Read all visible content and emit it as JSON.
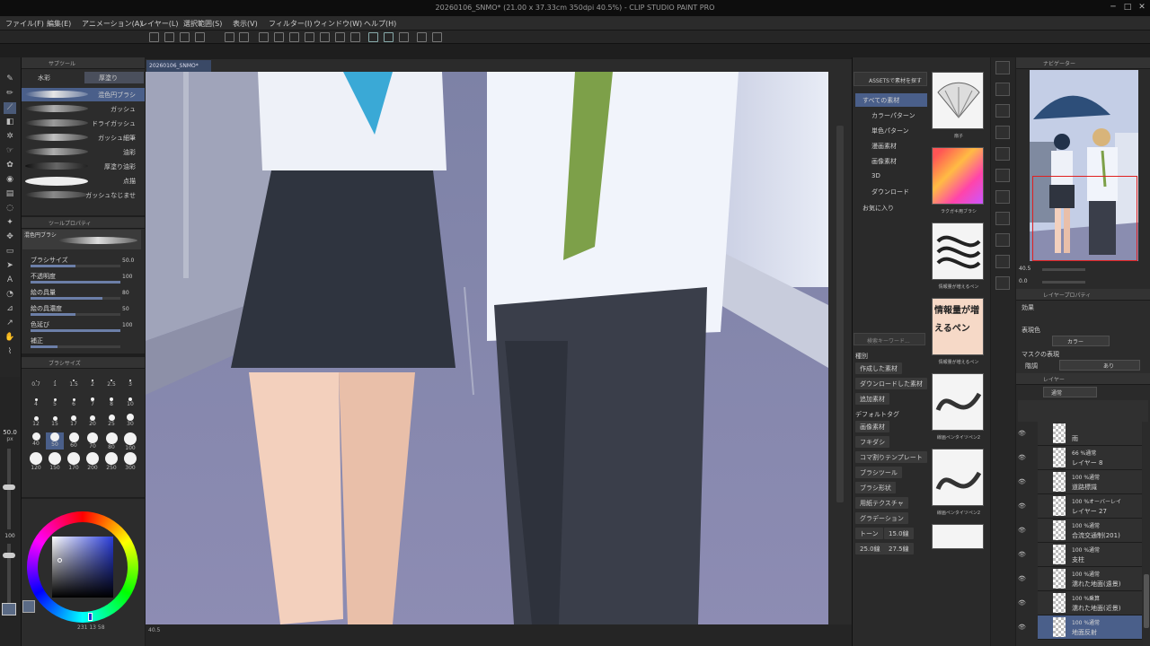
{
  "app": {
    "title": "20260106_SNMO* (21.00 x 37.33cm 350dpi 40.5%) - CLIP STUDIO PAINT PRO"
  },
  "menu": [
    "ファイル(F)",
    "編集(E)",
    "アニメーション(A)",
    "レイヤー(L)",
    "選択範囲(S)",
    "表示(V)",
    "フィルター(I)",
    "ウィンドウ(W)",
    "ヘルプ(H)"
  ],
  "subtool": {
    "panel_title": "サブツール",
    "tabs": [
      "水彩",
      "厚塗り"
    ],
    "brushes": [
      "混色円ブラシ",
      "ガッシュ",
      "ドライガッシュ",
      "ガッシュ細筆",
      "油彩",
      "厚塗り油彩",
      "点描",
      "ガッシュなじませ"
    ]
  },
  "tool_property": {
    "panel_title": "ツールプロパティ",
    "preview_name": "混色円ブラシ",
    "rows": [
      {
        "label": "ブラシサイズ",
        "value": "50.0",
        "fill": 0.5
      },
      {
        "label": "不透明度",
        "value": "100",
        "fill": 1.0
      },
      {
        "label": "絵の具量",
        "value": "80",
        "fill": 0.8
      },
      {
        "label": "絵の具濃度",
        "value": "50",
        "fill": 0.5
      },
      {
        "label": "色延び",
        "value": "100",
        "fill": 1.0
      },
      {
        "label": "補正",
        "value": "",
        "fill": 0.3
      }
    ]
  },
  "brush_size": {
    "panel_title": "ブラシサイズ",
    "labels": [
      "0.7",
      "1",
      "1.5",
      "2",
      "2.5",
      "3",
      "4",
      "5",
      "6",
      "7",
      "8",
      "10",
      "12",
      "15",
      "17",
      "20",
      "25",
      "30",
      "40",
      "50",
      "60",
      "70",
      "80",
      "100",
      "120",
      "150",
      "170",
      "200",
      "250",
      "300"
    ],
    "selected": "50"
  },
  "left_strip": {
    "size_display": "50.0",
    "unit": "px",
    "zoom": "100"
  },
  "color": {
    "readout": "231  13  58"
  },
  "canvas": {
    "tab": "20260106_SNMO*",
    "zoom": "40.5"
  },
  "materials": {
    "assets_label": "ASSETSで素材を探す",
    "tree": [
      "すべての素材",
      "カラーパターン",
      "単色パターン",
      "漫画素材",
      "画像素材",
      "3D",
      "ダウンロード",
      "お気に入り"
    ],
    "thumbs": [
      "扇子",
      "ラクガキ用ブラシ",
      "情報量が増えるペン",
      "情報量が増えるペン",
      "線画ペンタイツペン2",
      "線画ペンタイツペン2"
    ],
    "thumb_text": "情報量が増えるペン",
    "search_placeholder": "検索キーワード...",
    "type_head": "種別",
    "type_btns": [
      "作成した素材",
      "ダウンロードした素材",
      "追加素材"
    ],
    "tag_head": "デフォルトタグ",
    "tags": [
      "画像素材",
      "フキダシ",
      "コマ割りテンプレート",
      "ブラシツール",
      "ブラシ形状",
      "用紙テクスチャ",
      "グラデーション",
      "トーン",
      "15.0線",
      "25.0線",
      "27.5線"
    ]
  },
  "navigator": {
    "panel_title": "ナビゲーター",
    "zoom": "40.5",
    "angle": "0.0"
  },
  "layer_property": {
    "panel_title": "レイヤープロパティ",
    "effect_label": "効果",
    "color_label": "表現色",
    "color_value": "カラー",
    "mask_label": "マスクの表現",
    "mask_value": "階調",
    "mask_state": "あり"
  },
  "layers": {
    "panel_title": "レイヤー",
    "blend": "通常",
    "items": [
      {
        "mode": "",
        "name": "雨"
      },
      {
        "mode": "66 %通常",
        "name": "レイヤー 8"
      },
      {
        "mode": "100 %通常",
        "name": "道路標識"
      },
      {
        "mode": "100 %オーバーレイ",
        "name": "レイヤー 27"
      },
      {
        "mode": "100 %通常",
        "name": "合流交通制(201)"
      },
      {
        "mode": "100 %通常",
        "name": "支柱"
      },
      {
        "mode": "100 %通常",
        "name": "濡れた地面(遠景)"
      },
      {
        "mode": "100 %乗算",
        "name": "濡れた地面(近景)"
      },
      {
        "mode": "100 %通常",
        "name": "地面反射"
      }
    ]
  },
  "colors": {
    "accent": "#4a5f8a",
    "panel": "#2c2c2c",
    "canvas_bg": "#8b90ad"
  }
}
